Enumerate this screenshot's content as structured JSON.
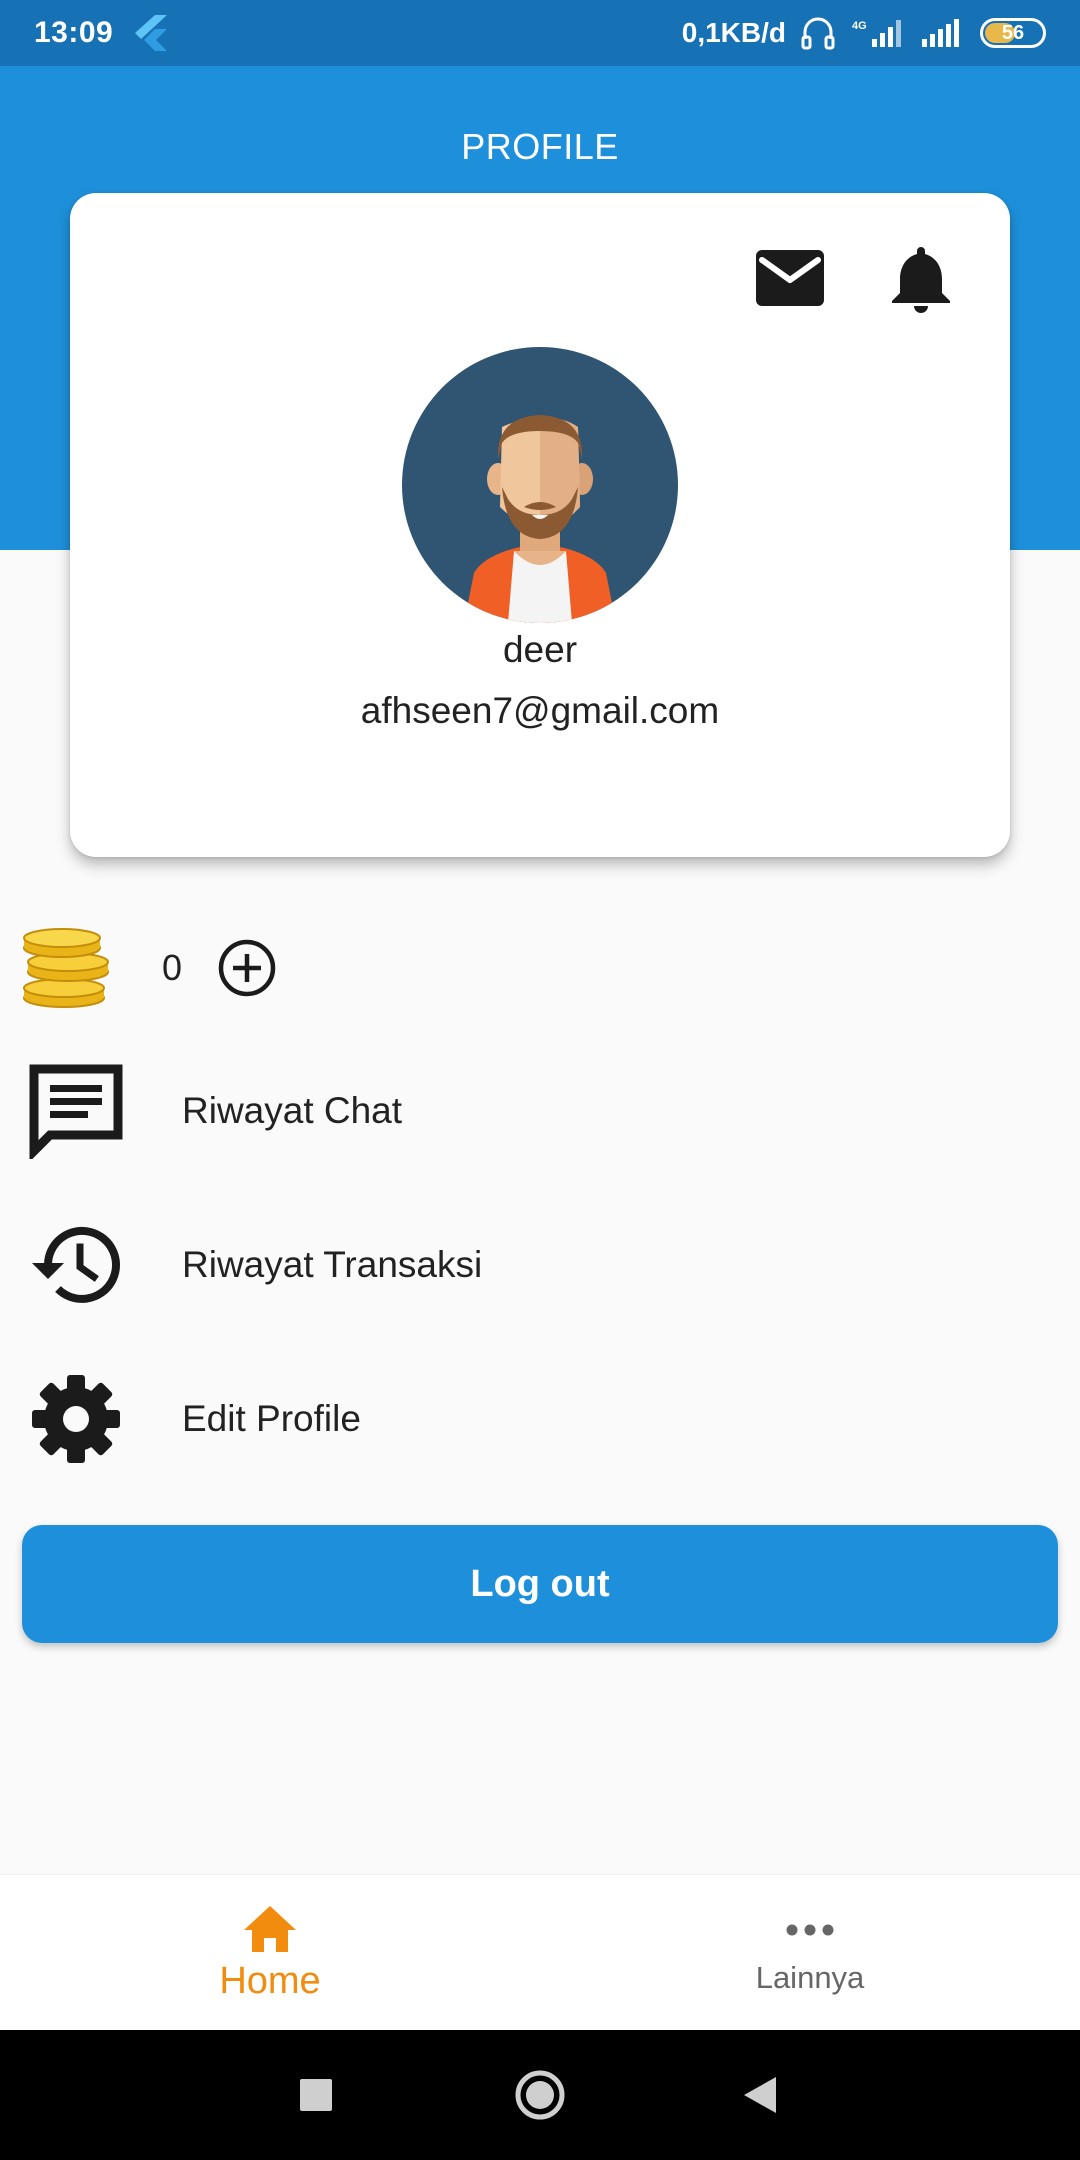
{
  "status_bar": {
    "time": "13:09",
    "net_speed": "0,1KB/d",
    "battery_level": "56",
    "battery_fraction": 0.56
  },
  "header": {
    "title": "PROFILE",
    "color": "#1e90db"
  },
  "profile": {
    "name": "deer",
    "email": "afhseen7@gmail.com",
    "icons": [
      "mail-icon",
      "bell-icon",
      "avatar-man-icon"
    ]
  },
  "coins": {
    "count": "0",
    "icon": "coin-stack-icon",
    "add_icon": "add-circle-icon"
  },
  "menu": {
    "items": [
      {
        "label": "Riwayat Chat",
        "icon": "chat-icon"
      },
      {
        "label": "Riwayat Transaksi",
        "icon": "history-icon"
      },
      {
        "label": "Edit Profile",
        "icon": "gear-icon"
      }
    ]
  },
  "logout": {
    "label": "Log out"
  },
  "bottom_nav": {
    "items": [
      {
        "label": "Home",
        "icon": "home-icon",
        "active": true
      },
      {
        "label": "Lainnya",
        "icon": "more-horiz-icon",
        "active": false
      }
    ],
    "active_color": "#f28c0f"
  },
  "system_nav": {
    "icons": [
      "recents-icon",
      "home-circle-icon",
      "back-icon"
    ]
  }
}
